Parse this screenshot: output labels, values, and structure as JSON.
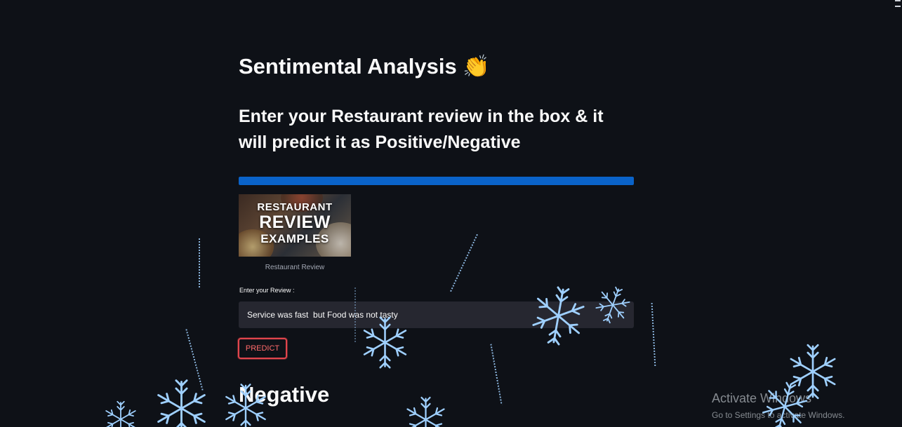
{
  "app": {
    "title": "Sentimental Analysis 👏",
    "subtitle": "Enter your Restaurant review in the box & it will predict it as Positive/Negative"
  },
  "progress": {
    "value_percent": 100,
    "color": "#0a63c9"
  },
  "image": {
    "line1": "RESTAURANT",
    "line2": "REVIEW",
    "line3": "EXAMPLES",
    "caption": "Restaurant Review"
  },
  "review": {
    "label": "Enter your Review :",
    "value": "Service was fast  but Food was not tasty"
  },
  "predict_button": {
    "label": "PREDICT",
    "border_color": "#e0454d"
  },
  "result": {
    "text": "Negative"
  },
  "windows_watermark": {
    "title": "Activate Windows",
    "subtitle": "Go to Settings to activate Windows."
  },
  "theme": {
    "background": "#0e1117",
    "snow_color": "#9fd0ff"
  }
}
